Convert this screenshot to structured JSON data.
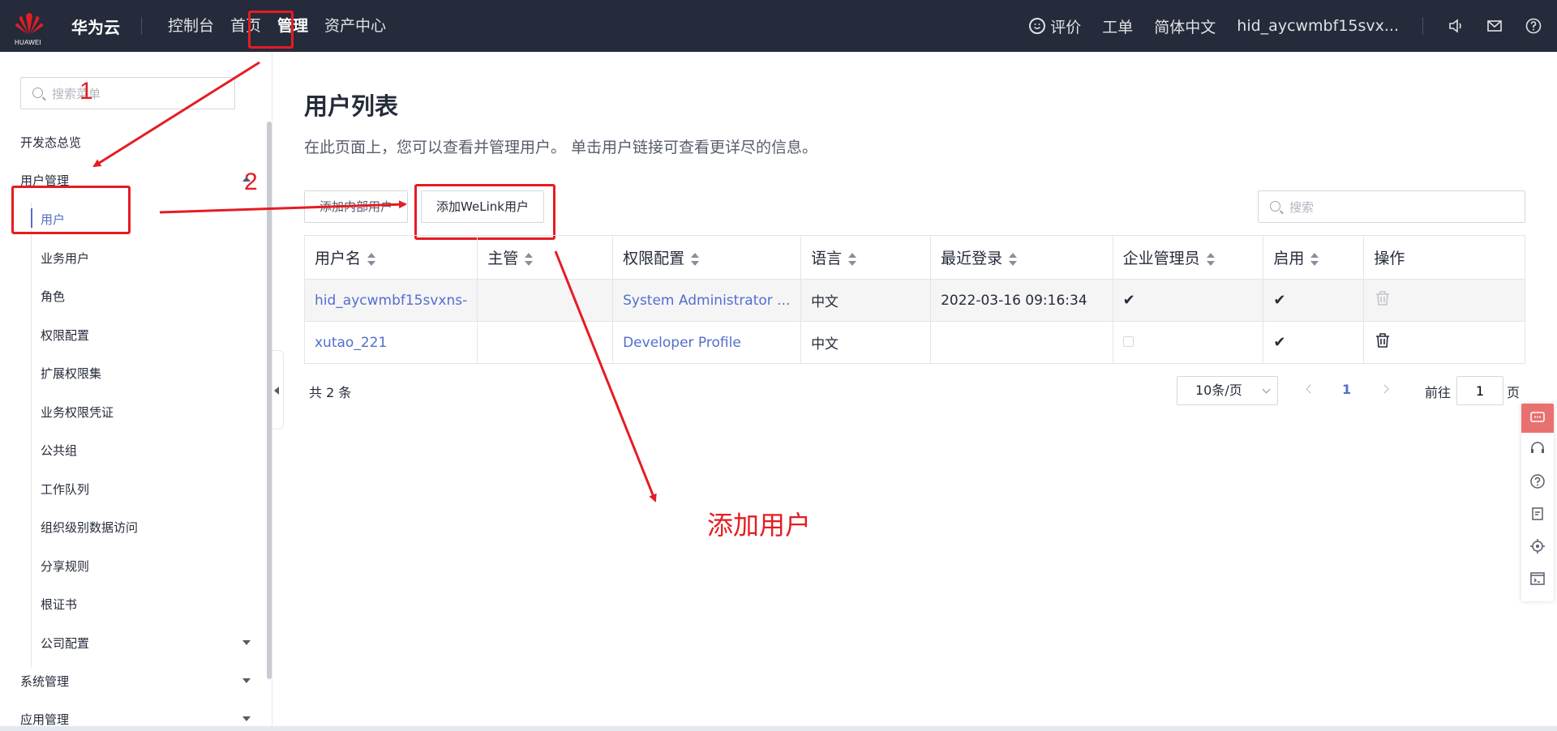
{
  "header": {
    "logo_text": "HUAWEI",
    "brand": "华为云",
    "nav": [
      "控制台",
      "首页",
      "管理",
      "资产中心"
    ],
    "active_nav": "管理",
    "right": {
      "feedback": "评价",
      "ticket": "工单",
      "language": "简体中文",
      "user": "hid_aycwmbf15svx..."
    }
  },
  "sidebar": {
    "search_placeholder": "搜索菜单",
    "overview": "开发态总览",
    "user_mgmt": "用户管理",
    "sub_items": [
      "用户",
      "业务用户",
      "角色",
      "权限配置",
      "扩展权限集",
      "业务权限凭证",
      "公共组",
      "工作队列",
      "组织级别数据访问",
      "分享规则",
      "根证书",
      "公司配置"
    ],
    "active_sub": "用户",
    "system_mgmt": "系统管理",
    "app_mgmt": "应用管理"
  },
  "main": {
    "title": "用户列表",
    "description": "在此页面上，您可以查看并管理用户。 单击用户链接可查看更详尽的信息。",
    "add_button": "添加内部用户",
    "welink_button": "添加WeLink用户",
    "search_placeholder": "搜索",
    "columns": [
      "用户名",
      "主管",
      "权限配置",
      "语言",
      "最近登录",
      "企业管理员",
      "启用",
      "操作"
    ],
    "rows": [
      {
        "username": "hid_aycwmbf15svxns-",
        "manager": "",
        "profile": "System Administrator ...",
        "language": "中文",
        "last_login": "2022-03-16 09:16:34",
        "admin": true,
        "enabled": true
      },
      {
        "username": "xutao_221",
        "manager": "",
        "profile": "Developer Profile",
        "language": "中文",
        "last_login": "",
        "admin": false,
        "enabled": true
      }
    ],
    "total": "共 2 条",
    "page_size": "10条/页",
    "current_page": "1",
    "goto_label": "前往",
    "goto_value": "1",
    "goto_suffix": "页"
  },
  "annotations": {
    "num1": "1",
    "num2": "2",
    "label": "添加用户",
    "color": "#e51c23"
  },
  "icons": [
    "huawei-logo",
    "smile-icon",
    "speaker-icon",
    "mail-icon",
    "help-icon",
    "search-icon",
    "sort-icon",
    "check-icon",
    "delete-icon",
    "chat-icon",
    "headset-icon",
    "question-icon",
    "note-icon",
    "target-icon",
    "terminal-icon"
  ]
}
